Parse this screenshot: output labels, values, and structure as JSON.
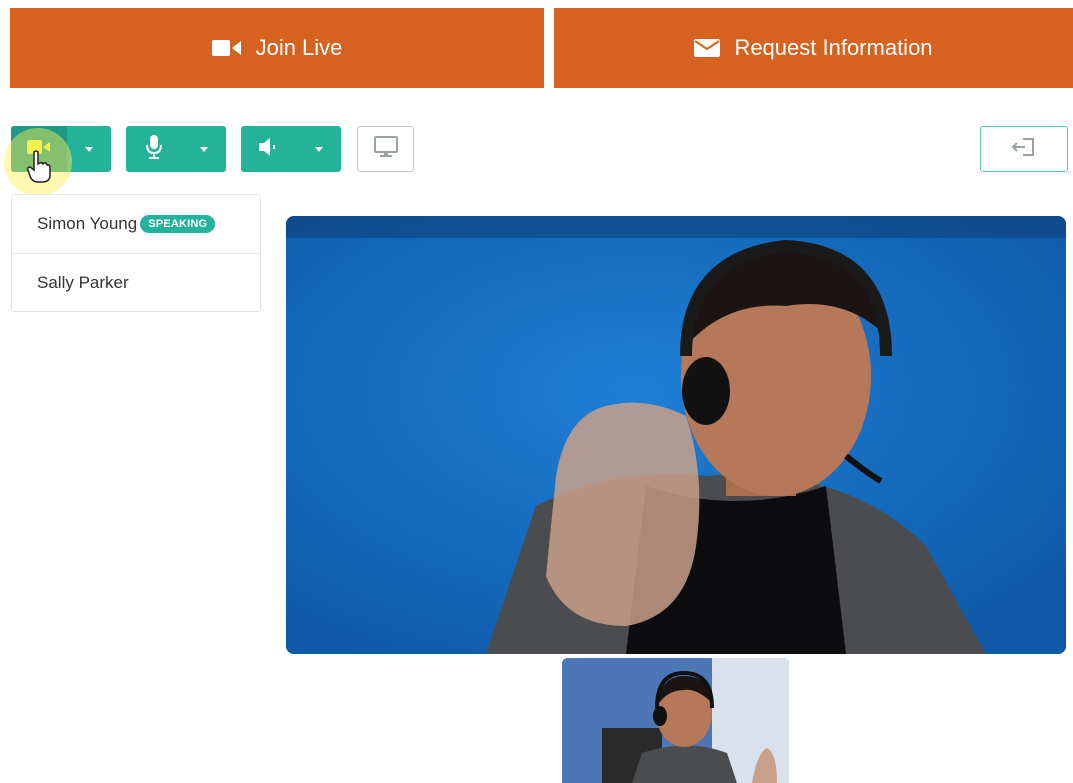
{
  "header": {
    "join_live_label": "Join Live",
    "request_info_label": "Request Information"
  },
  "controls": {
    "camera": "camera-icon",
    "microphone": "microphone-icon",
    "speaker": "speaker-icon",
    "screen_share": "monitor-icon",
    "leave": "exit-icon"
  },
  "participants": [
    {
      "name": "Simon Young",
      "badge": "SPEAKING"
    },
    {
      "name": "Sally Parker"
    }
  ],
  "colors": {
    "accent_orange": "#d5621f",
    "accent_teal": "#25b29a",
    "video_bg": "#1a72c7"
  }
}
